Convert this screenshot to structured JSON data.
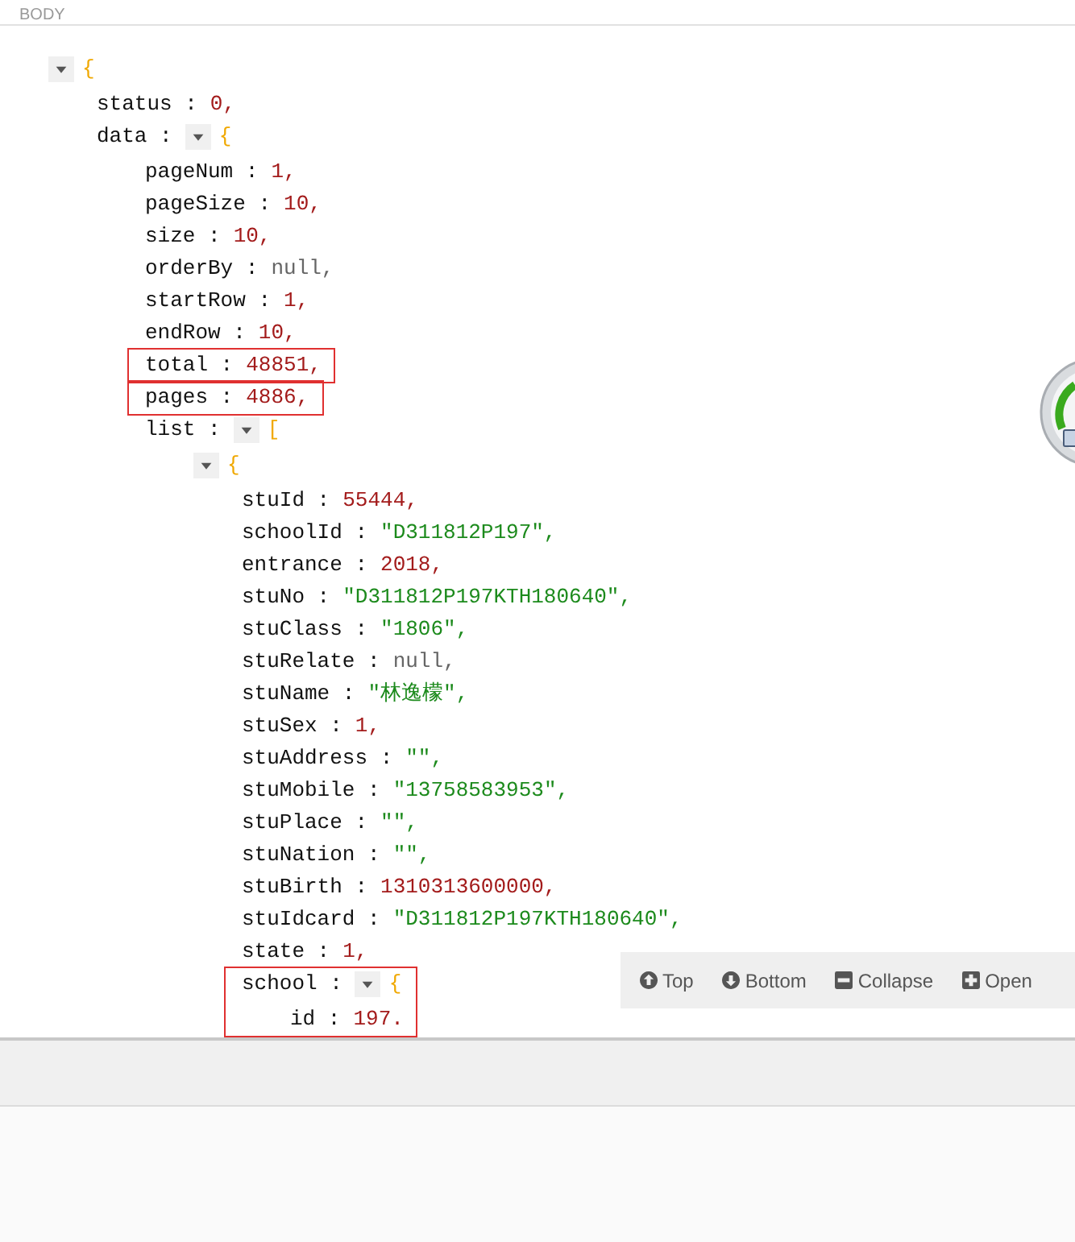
{
  "header": {
    "title": "BODY"
  },
  "tree": {
    "kind": "object",
    "open": "{",
    "expanded": true,
    "children": [
      {
        "key": "status :",
        "kind": "number",
        "value": "0,"
      },
      {
        "key": "data :",
        "kind": "object",
        "open": "{",
        "expanded": true,
        "children": [
          {
            "key": "pageNum :",
            "kind": "number",
            "value": "1,"
          },
          {
            "key": "pageSize :",
            "kind": "number",
            "value": "10,"
          },
          {
            "key": "size :",
            "kind": "number",
            "value": "10,"
          },
          {
            "key": "orderBy :",
            "kind": "null",
            "value": "null,"
          },
          {
            "key": "startRow :",
            "kind": "number",
            "value": "1,"
          },
          {
            "key": "endRow :",
            "kind": "number",
            "value": "10,"
          },
          {
            "key": "total :",
            "kind": "number",
            "value": "48851,",
            "highlighted": true
          },
          {
            "key": "pages :",
            "kind": "number",
            "value": "4886,",
            "highlighted": true
          },
          {
            "key": "list :",
            "kind": "array",
            "open": "[",
            "expanded": true,
            "children": [
              {
                "kind": "object",
                "open": "{",
                "expanded": true,
                "children": [
                  {
                    "key": "stuId :",
                    "kind": "number",
                    "value": "55444,"
                  },
                  {
                    "key": "schoolId :",
                    "kind": "string",
                    "value": "\"D311812P197\","
                  },
                  {
                    "key": "entrance :",
                    "kind": "number",
                    "value": "2018,"
                  },
                  {
                    "key": "stuNo :",
                    "kind": "string",
                    "value": "\"D311812P197KTH180640\","
                  },
                  {
                    "key": "stuClass :",
                    "kind": "string",
                    "value": "\"1806\","
                  },
                  {
                    "key": "stuRelate :",
                    "kind": "null",
                    "value": "null,"
                  },
                  {
                    "key": "stuName :",
                    "kind": "string",
                    "value": "\"林逸檬\","
                  },
                  {
                    "key": "stuSex :",
                    "kind": "number",
                    "value": "1,"
                  },
                  {
                    "key": "stuAddress :",
                    "kind": "string",
                    "value": "\"\","
                  },
                  {
                    "key": "stuMobile :",
                    "kind": "string",
                    "value": "\"13758583953\","
                  },
                  {
                    "key": "stuPlace :",
                    "kind": "string",
                    "value": "\"\","
                  },
                  {
                    "key": "stuNation :",
                    "kind": "string",
                    "value": "\"\","
                  },
                  {
                    "key": "stuBirth :",
                    "kind": "number",
                    "value": "1310313600000,"
                  },
                  {
                    "key": "stuIdcard :",
                    "kind": "string",
                    "value": "\"D311812P197KTH180640\","
                  },
                  {
                    "key": "state :",
                    "kind": "number",
                    "value": "1,"
                  },
                  {
                    "key": "school :",
                    "kind": "object",
                    "open": "{",
                    "expanded": true,
                    "highlighted": true,
                    "children": [
                      {
                        "key": "id :",
                        "kind": "number",
                        "value": "197."
                      }
                    ]
                  }
                ]
              }
            ]
          }
        ]
      }
    ]
  },
  "toolbar": [
    {
      "kind": "up",
      "label": "Top"
    },
    {
      "kind": "down",
      "label": "Bottom"
    },
    {
      "kind": "minus",
      "label": "Collapse"
    },
    {
      "kind": "plus",
      "label": "Open"
    }
  ]
}
